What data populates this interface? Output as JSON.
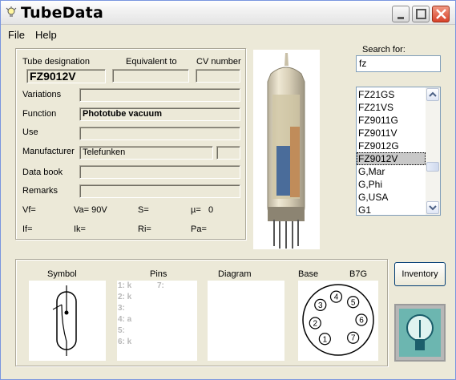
{
  "window": {
    "title": "TubeData"
  },
  "menu": [
    "File",
    "Help"
  ],
  "details": {
    "designation_label": "Tube designation",
    "designation": "FZ9012V",
    "equivalent_label": "Equivalent to",
    "equivalent": "",
    "cv_label": "CV number",
    "cv": "",
    "variations_label": "Variations",
    "variations": "",
    "function_label": "Function",
    "function": "Phototube vacuum",
    "use_label": "Use",
    "use": "",
    "manufacturer_label": "Manufacturer",
    "manufacturer": "Telefunken",
    "manufacturer_extra": "",
    "databook_label": "Data book",
    "databook": "",
    "remarks_label": "Remarks",
    "remarks": "",
    "params": {
      "vf": "Vf=",
      "va": "Va= 90V",
      "s": "S=",
      "mu": "µ=",
      "mu_val": "0",
      "if": "If=",
      "ik": "Ik=",
      "ri": "Ri=",
      "pa": "Pa="
    }
  },
  "search": {
    "label": "Search for:",
    "value": "fz",
    "results": [
      "FZ21GS",
      "FZ21VS",
      "FZ9011G",
      "FZ9011V",
      "FZ9012G",
      "FZ9012V",
      "G,Mar",
      "G,Phi",
      "G,USA",
      "G1"
    ],
    "selected_index": 5
  },
  "bottom": {
    "symbol_label": "Symbol",
    "pins_label": "Pins",
    "diagram_label": "Diagram",
    "base_label": "Base",
    "base_type": "B7G",
    "pins_col1": [
      "1: k",
      "2: k",
      "3:",
      "4: a",
      "5:",
      "6: k"
    ],
    "pins_col2": [
      "7:"
    ],
    "base_pins": [
      "1",
      "2",
      "3",
      "4",
      "5",
      "6",
      "7"
    ]
  },
  "inventory_button": "Inventory",
  "icons": {
    "app": "lightbulb-icon",
    "minimize": "minimize-icon",
    "maximize": "maximize-icon",
    "close": "close-icon",
    "scroll_up": "arrow-up-icon",
    "scroll_down": "arrow-down-icon"
  },
  "colors": {
    "window_bg": "#ece9d8",
    "close_button": "#d8422a",
    "selection": "#c8c8c8",
    "input_border": "#7f9db9",
    "pin_text": "#b8b8b8"
  }
}
